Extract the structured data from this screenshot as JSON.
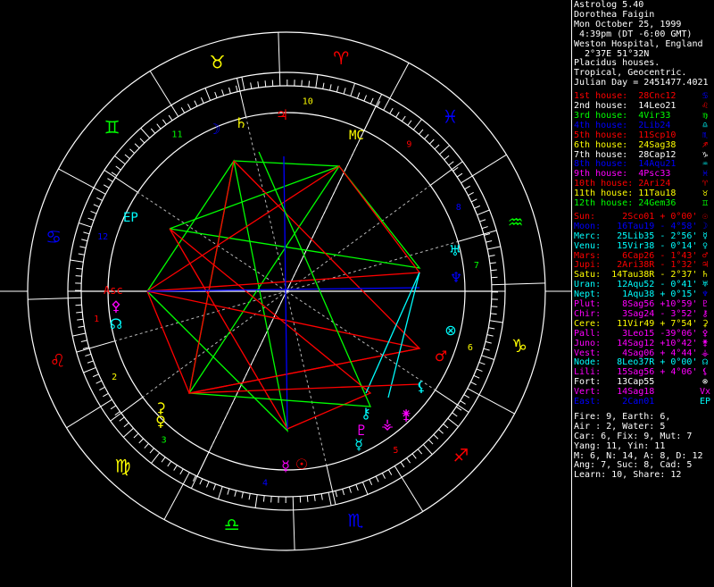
{
  "header": {
    "lines": [
      "Astrolog 5.40",
      "Dorothea Faigin",
      "Mon October 25, 1999",
      " 4:39pm (DT -6:00 GMT)",
      "Weston Hospital, England",
      "  2°37E 51°32N",
      "Placidus houses.",
      "Tropical, Geocentric.",
      "Julian Day = 2451477.4021"
    ]
  },
  "houses": [
    {
      "label": "1st house:",
      "value": "28Cnc12",
      "color": "#ff0000",
      "sign": "♋",
      "sign_color": "#0000ff"
    },
    {
      "label": "2nd house:",
      "value": "14Leo21",
      "color": "#ffffff",
      "sign": "♌",
      "sign_color": "#ff0000"
    },
    {
      "label": "3rd house:",
      "value": "4Vir33",
      "color": "#00ff00",
      "sign": "♍",
      "sign_color": "#00ff00"
    },
    {
      "label": "4th house:",
      "value": "2Lib24",
      "color": "#0000ff",
      "sign": "♎",
      "sign_color": "#00ffff"
    },
    {
      "label": "5th house:",
      "value": "11Scp10",
      "color": "#ff0000",
      "sign": "♏",
      "sign_color": "#0000ff"
    },
    {
      "label": "6th house:",
      "value": "24Sag38",
      "color": "#ffff00",
      "sign": "♐",
      "sign_color": "#ff0000"
    },
    {
      "label": "7th house:",
      "value": "28Cap12",
      "color": "#ffffff",
      "sign": "♑",
      "sign_color": "#ffffff"
    },
    {
      "label": "8th house:",
      "value": "14Aqu21",
      "color": "#0000ff",
      "sign": "♒",
      "sign_color": "#00ffff"
    },
    {
      "label": "9th house:",
      "value": "4Psc33",
      "color": "#ff00ff",
      "sign": "♓",
      "sign_color": "#0000ff"
    },
    {
      "label": "10th house:",
      "value": "2Ari24",
      "color": "#ff0000",
      "sign": "♈",
      "sign_color": "#ff0000"
    },
    {
      "label": "11th house:",
      "value": "11Tau18",
      "color": "#ffff00",
      "sign": "♉",
      "sign_color": "#ffff00"
    },
    {
      "label": "12th house:",
      "value": "24Gem36",
      "color": "#00ff00",
      "sign": "♊",
      "sign_color": "#00ff00"
    }
  ],
  "planets": [
    {
      "name": "Sun:",
      "pos": "2Sco01",
      "lat": "+ 0°00'",
      "color": "#ff0000",
      "sign": "☉",
      "sign_color": "#ff0000"
    },
    {
      "name": "Moon:",
      "pos": "16Tau19",
      "lat": "- 4°58'",
      "color": "#0000ff",
      "sign": "☽",
      "sign_color": "#0000ff"
    },
    {
      "name": "Merc:",
      "pos": "25Lib35",
      "lat": "- 2°56'",
      "color": "#00ffff",
      "sign": "☿",
      "sign_color": "#00ffff"
    },
    {
      "name": "Venu:",
      "pos": "15Vir38",
      "lat": "- 0°14'",
      "color": "#00ffff",
      "sign": "♀",
      "sign_color": "#00ffff"
    },
    {
      "name": "Mars:",
      "pos": "6Cap26",
      "lat": "- 1°43'",
      "color": "#ff0000",
      "sign": "♂",
      "sign_color": "#ff0000"
    },
    {
      "name": "Jupi:",
      "pos": "2Ari38R",
      "lat": "- 1°32'",
      "color": "#ff0000",
      "sign": "♃",
      "sign_color": "#ff0000"
    },
    {
      "name": "Satu:",
      "pos": "14Tau38R",
      "lat": "- 2°37'",
      "color": "#ffff00",
      "sign": "♄",
      "sign_color": "#ffff00"
    },
    {
      "name": "Uran:",
      "pos": "12Aqu52",
      "lat": "- 0°41'",
      "color": "#00ffff",
      "sign": "♅",
      "sign_color": "#00ffff"
    },
    {
      "name": "Nept:",
      "pos": "1Aqu38",
      "lat": "+ 0°15'",
      "color": "#00ffff",
      "sign": "♆",
      "sign_color": "#0000ff"
    },
    {
      "name": "Plut:",
      "pos": "8Sag56",
      "lat": "+10°59'",
      "color": "#ff00ff",
      "sign": "♇",
      "sign_color": "#ff00ff"
    },
    {
      "name": "Chir:",
      "pos": "3Sag24",
      "lat": "- 3°52'",
      "color": "#ff00ff",
      "sign": "⚷",
      "sign_color": "#ff00ff"
    },
    {
      "name": "Cere:",
      "pos": "11Vir49",
      "lat": "+ 7°54'",
      "color": "#ffff00",
      "sign": "⚳",
      "sign_color": "#ffff00"
    },
    {
      "name": "Pall:",
      "pos": "3Leo15",
      "lat": "-39°06'",
      "color": "#ff00ff",
      "sign": "⚴",
      "sign_color": "#ff00ff"
    },
    {
      "name": "Juno:",
      "pos": "14Sag12",
      "lat": "+10°42'",
      "color": "#ff00ff",
      "sign": "⚵",
      "sign_color": "#ff00ff"
    },
    {
      "name": "Vest:",
      "pos": "4Sag06",
      "lat": "+ 4°44'",
      "color": "#ff00ff",
      "sign": "⚶",
      "sign_color": "#ff00ff"
    },
    {
      "name": "Node:",
      "pos": "8Leo37R",
      "lat": "+ 0°00'",
      "color": "#00ffff",
      "sign": "☊",
      "sign_color": "#00ffff"
    },
    {
      "name": "Lili:",
      "pos": "15Sag56",
      "lat": "+ 4°06'",
      "color": "#ff00ff",
      "sign": "⚸",
      "sign_color": "#ff00ff"
    },
    {
      "name": "Fort:",
      "pos": "13Cap55",
      "lat": "",
      "color": "#ffffff",
      "sign": "⊗",
      "sign_color": "#ffffff"
    },
    {
      "name": "Vert:",
      "pos": "14Sag18",
      "lat": "",
      "color": "#ff00ff",
      "sign": "Vx",
      "sign_color": "#ff00ff"
    },
    {
      "name": "East:",
      "pos": "2Can01",
      "lat": "",
      "color": "#0000ff",
      "sign": "EP",
      "sign_color": "#00ffff"
    }
  ],
  "stats": [
    "Fire: 9, Earth: 6,",
    "Air : 2, Water: 5",
    "Car: 6, Fix: 9, Mut: 7",
    "Yang: 11, Yin: 11",
    "M: 6, N: 14, A: 8, D: 12",
    "Ang: 7, Suc: 8, Cad: 5",
    "Learn: 10, Share: 12"
  ],
  "wheel": {
    "signs": [
      {
        "sym": "♈",
        "color": "#ff0000"
      },
      {
        "sym": "♉",
        "color": "#ffff00"
      },
      {
        "sym": "♊",
        "color": "#00ff00"
      },
      {
        "sym": "♋",
        "color": "#0000ff"
      },
      {
        "sym": "♌",
        "color": "#ff0000"
      },
      {
        "sym": "♍",
        "color": "#ffff00"
      },
      {
        "sym": "♎",
        "color": "#00ff00"
      },
      {
        "sym": "♏",
        "color": "#0000ff"
      },
      {
        "sym": "♐",
        "color": "#ff0000"
      },
      {
        "sym": "♑",
        "color": "#ffff00"
      },
      {
        "sym": "♒",
        "color": "#00ff00"
      },
      {
        "sym": "♓",
        "color": "#0000ff"
      }
    ],
    "house_numbers": [
      {
        "n": "1",
        "color": "#ff0000"
      },
      {
        "n": "2",
        "color": "#ffff00"
      },
      {
        "n": "3",
        "color": "#00ff00"
      },
      {
        "n": "4",
        "color": "#0000ff"
      },
      {
        "n": "5",
        "color": "#ff0000"
      },
      {
        "n": "6",
        "color": "#ffff00"
      },
      {
        "n": "7",
        "color": "#00ff00"
      },
      {
        "n": "8",
        "color": "#0000ff"
      },
      {
        "n": "9",
        "color": "#ff0000"
      },
      {
        "n": "10",
        "color": "#ffff00"
      },
      {
        "n": "11",
        "color": "#00ff00"
      },
      {
        "n": "12",
        "color": "#0000ff"
      }
    ],
    "angle_labels": [
      {
        "text": "Asc",
        "color": "#ff0000"
      },
      {
        "text": "MC",
        "color": "#ffff00"
      },
      {
        "text": "EP",
        "color": "#00ffff"
      }
    ]
  }
}
